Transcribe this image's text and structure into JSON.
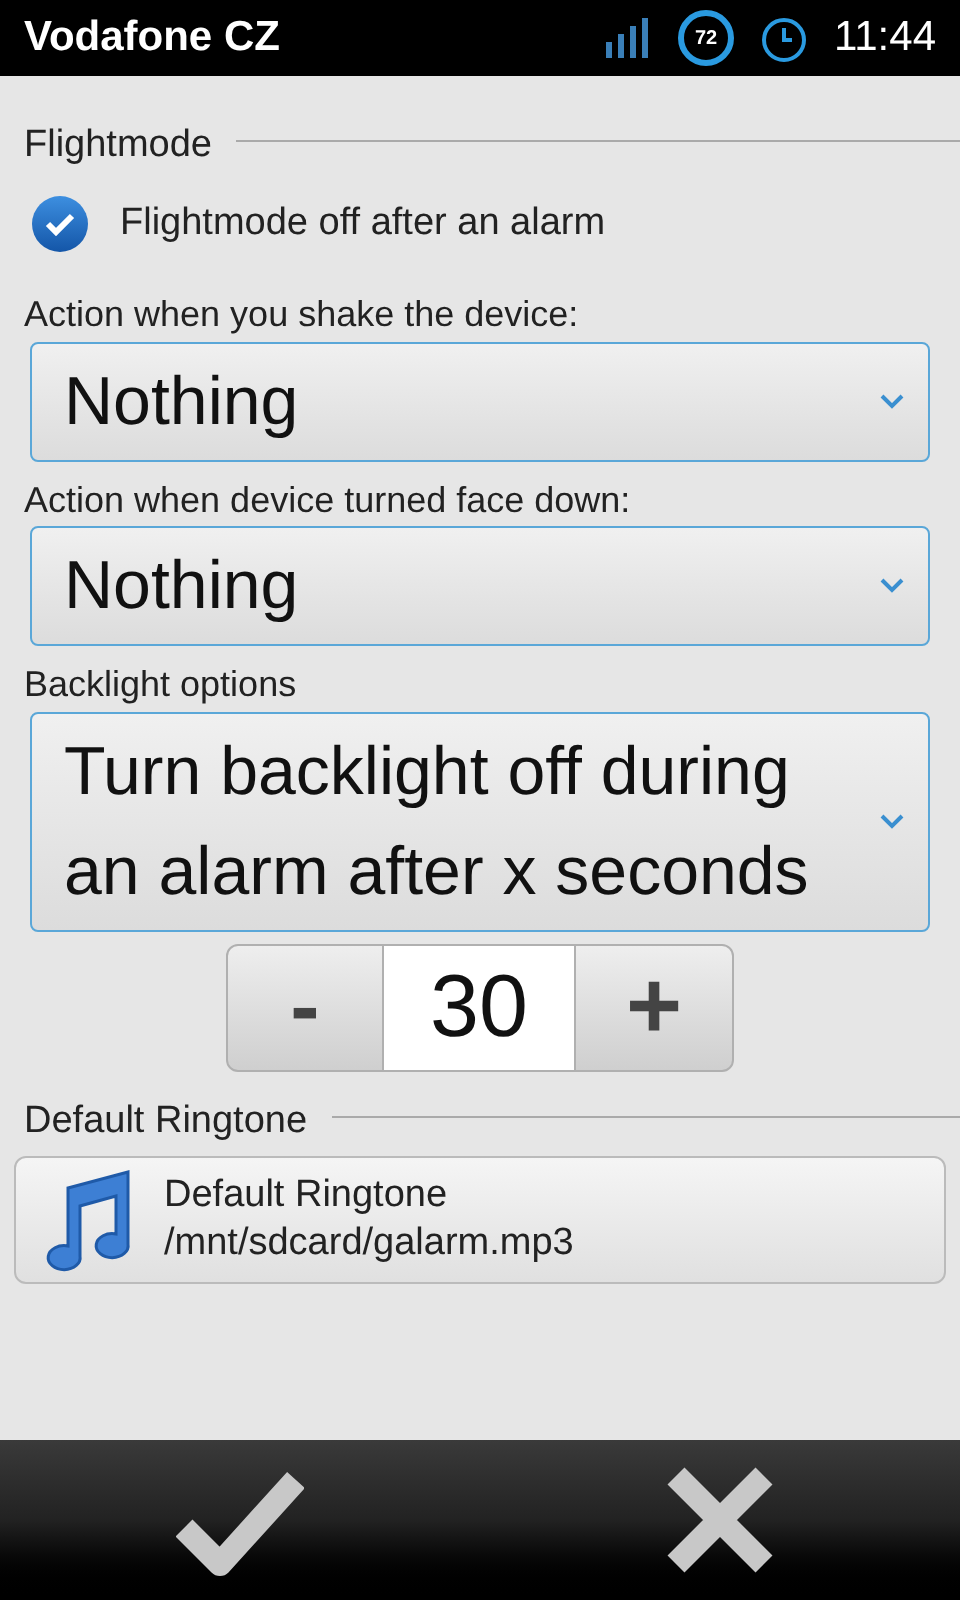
{
  "status_bar": {
    "carrier": "Vodafone CZ",
    "battery": "72",
    "time": "11:44"
  },
  "sections": [
    {
      "kind": "header",
      "title": "Flightmode"
    },
    {
      "kind": "checkbox",
      "label": "Flightmode off after an alarm",
      "checked": true
    },
    {
      "kind": "label",
      "title": "Action when you shake the device:"
    },
    {
      "kind": "select",
      "value": "Nothing"
    },
    {
      "kind": "label",
      "title": "Action when device turned face down:"
    },
    {
      "kind": "select",
      "value": "Nothing"
    },
    {
      "kind": "label",
      "title": "Backlight options"
    },
    {
      "kind": "select",
      "value": "Turn backlight off during an alarm after x seconds"
    },
    {
      "kind": "stepper",
      "minus": "-",
      "value": "30",
      "plus": "+"
    },
    {
      "kind": "header",
      "title": "Default Ringtone"
    },
    {
      "kind": "ringtone",
      "title": "Default Ringtone",
      "path": "/mnt/sdcard/galarm.mp3"
    }
  ]
}
